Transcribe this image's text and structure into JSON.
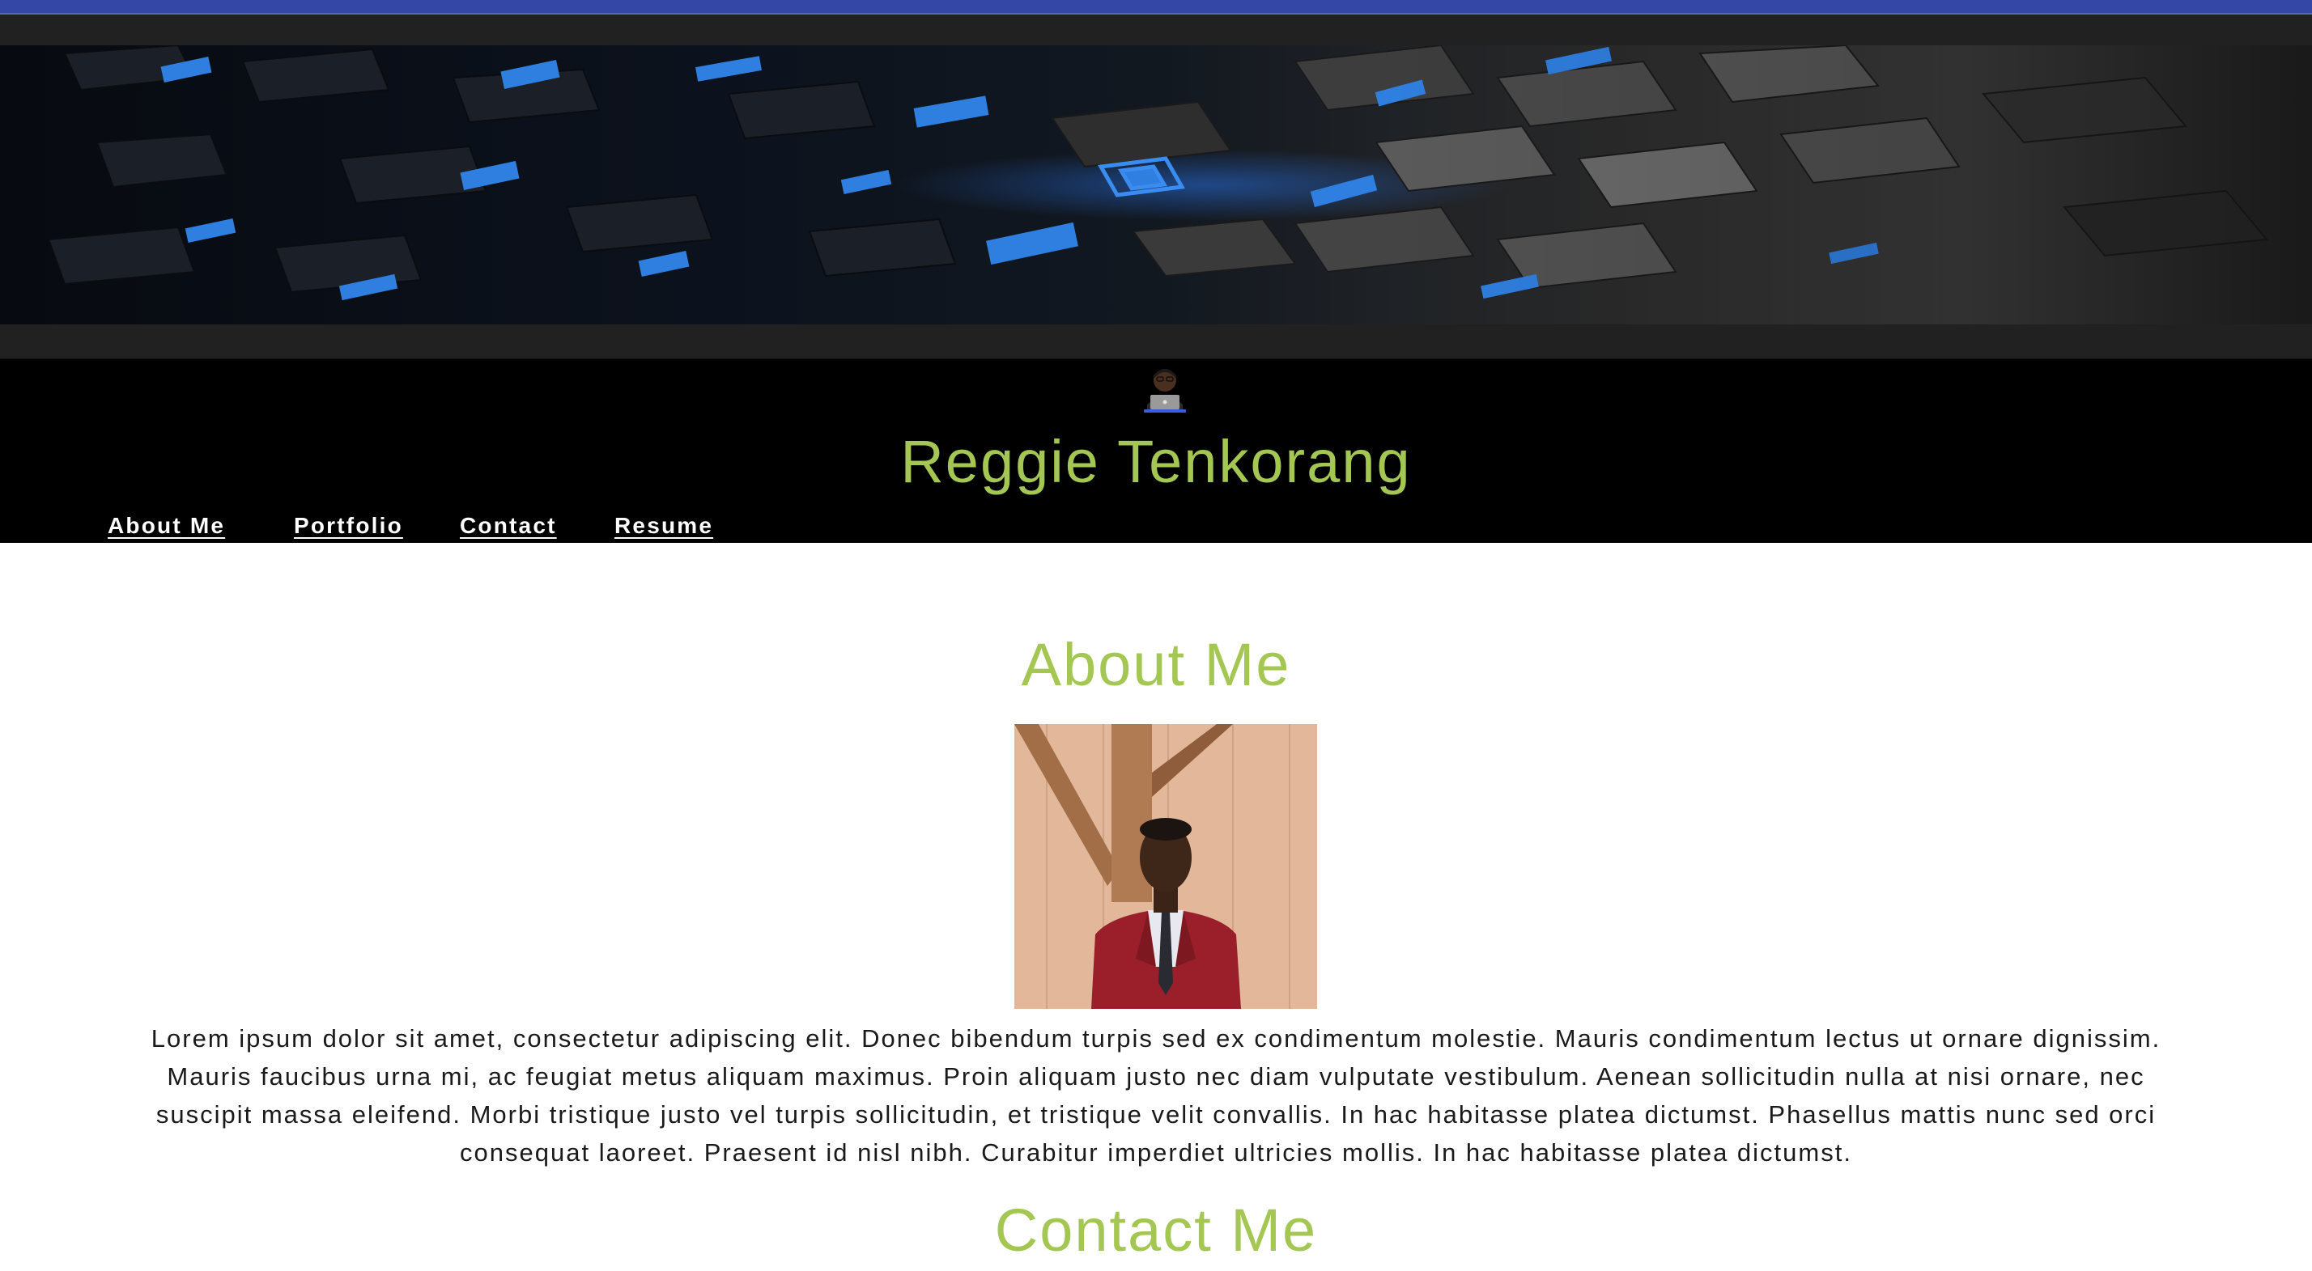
{
  "header": {
    "avatar_icon": "person-with-laptop-icon",
    "site_title": "Reggie Tenkorang",
    "nav": [
      {
        "label": "About Me"
      },
      {
        "label": "Portfolio"
      },
      {
        "label": "Contact"
      },
      {
        "label": "Resume"
      }
    ]
  },
  "banner": {
    "icon": "tech-cubes-banner-image"
  },
  "about": {
    "title": "About Me",
    "portrait_icon": "profile-photo",
    "bio": "Lorem ipsum dolor sit amet, consectetur adipiscing elit. Donec bibendum turpis sed ex condimentum molestie. Mauris condimentum lectus ut ornare dignissim. Mauris faucibus urna mi, ac feugiat metus aliquam maximus. Proin aliquam justo nec diam vulputate vestibulum. Aenean sollicitudin nulla at nisi ornare, nec suscipit massa eleifend. Morbi tristique justo vel turpis sollicitudin, et tristique velit convallis. In hac habitasse platea dictumst. Phasellus mattis nunc sed orci consequat laoreet. Praesent id nisl nibh. Curabitur imperdiet ultricies mollis. In hac habitasse platea dictumst."
  },
  "contact": {
    "title": "Contact Me"
  },
  "colors": {
    "accent": "#a4c653",
    "header_bg": "#000000",
    "top_strip": "#3446a6",
    "nav_text": "#ffffff"
  }
}
